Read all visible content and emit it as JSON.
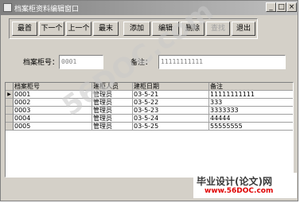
{
  "window": {
    "title": "档案柜资料编辑窗口"
  },
  "window_buttons": {
    "minimize": "_",
    "maximize": "□",
    "close": "×"
  },
  "toolbar": [
    "最首",
    "下一个",
    "上一个",
    "最末",
    "添加",
    "编辑",
    "删除",
    "查找",
    "退出"
  ],
  "form": {
    "id_label": "档案柜号：",
    "id_value": "0001",
    "note_label": "备注：",
    "note_value": "11111111111"
  },
  "table": {
    "columns": [
      "档案柜号",
      "建柜人员",
      "建柜日期",
      "备注"
    ],
    "rows": [
      [
        "0001",
        "管理员",
        "03-5-21",
        "11111111111"
      ],
      [
        "0002",
        "管理员",
        "03-5-22",
        "333"
      ],
      [
        "0003",
        "管理员",
        "03-5-23",
        "3333333"
      ],
      [
        "0004",
        "管理员",
        "03-5-24",
        "44444"
      ],
      [
        "0005",
        "管理员",
        "03-5-25",
        "55555555"
      ]
    ],
    "selected_row": 0,
    "row_indicator": "▶"
  },
  "watermark": {
    "main": "56DOC.com",
    "line1": "毕业设计(论文)网",
    "line2": "www.56DOC.com"
  }
}
